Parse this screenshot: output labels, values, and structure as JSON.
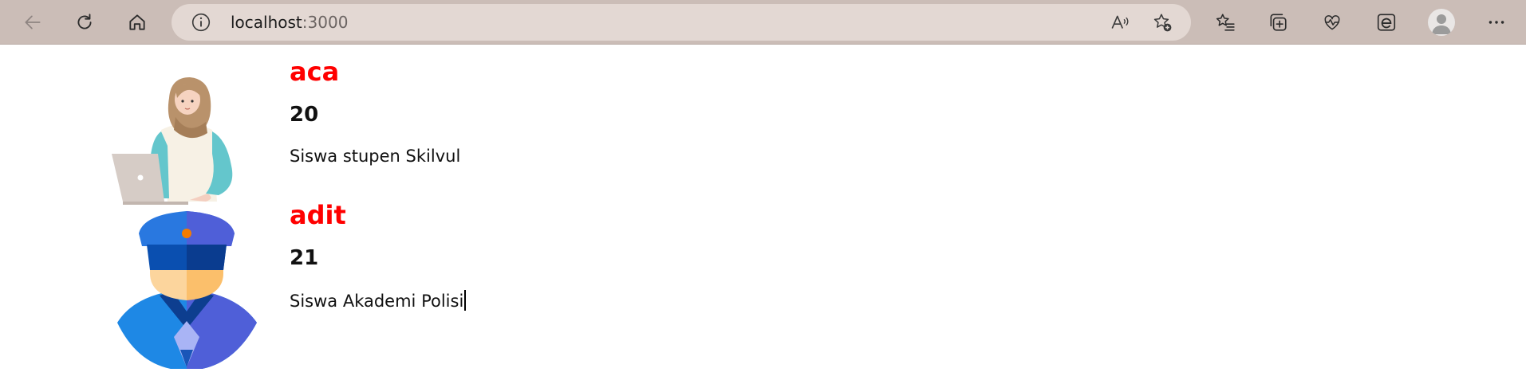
{
  "browser": {
    "url_host": "localhost",
    "url_port": ":3000",
    "icons": [
      "back-icon",
      "refresh-icon",
      "home-icon",
      "site-info-icon",
      "read-aloud-icon",
      "add-favorite-icon",
      "favorites-icon",
      "collections-icon",
      "health-icon",
      "extension-icon",
      "profile-icon",
      "more-icon"
    ]
  },
  "students": [
    {
      "name": "aca",
      "age": "20",
      "description": "Siswa stupen Skilvul",
      "avatar": "hijab-woman-laptop-illustration"
    },
    {
      "name": "adit",
      "age": "21",
      "description": "Siswa Akademi Polisi",
      "avatar": "police-officer-illustration"
    }
  ],
  "colors": {
    "name": "#ff0000",
    "toolbar": "#cbbdb7",
    "addressbar": "#e3d8d3"
  }
}
